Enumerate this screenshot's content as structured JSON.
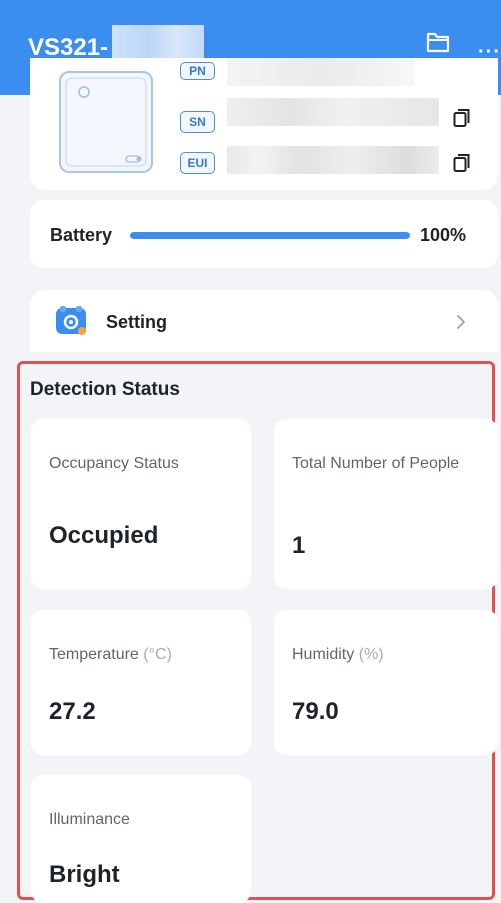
{
  "header": {
    "title": "VS321-",
    "folder_icon": "folder-icon",
    "more_icon": "more-icon",
    "more_glyph": "···",
    "background": "#3b8ef0"
  },
  "device": {
    "tags": {
      "pn": "PN",
      "sn": "SN",
      "eui": "EUI"
    },
    "copy_icon": "copy-icon"
  },
  "battery": {
    "label": "Battery",
    "value": "100%",
    "level": 1.0
  },
  "setting": {
    "label": "Setting",
    "icon": "setting-icon",
    "chevron_icon": "chevron-right-icon"
  },
  "detection": {
    "title": "Detection Status",
    "highlight_color": "#e35050",
    "occupancy": {
      "label": "Occupancy Status",
      "value": "Occupied"
    },
    "people": {
      "label": "Total Number of People",
      "value": "1"
    },
    "temperature": {
      "label": "Temperature",
      "unit": "(°C)",
      "value": "27.2"
    },
    "humidity": {
      "label": "Humidity",
      "unit": "(%)",
      "value": "79.0"
    },
    "illuminance": {
      "label": "Illuminance",
      "value": "Bright"
    }
  }
}
